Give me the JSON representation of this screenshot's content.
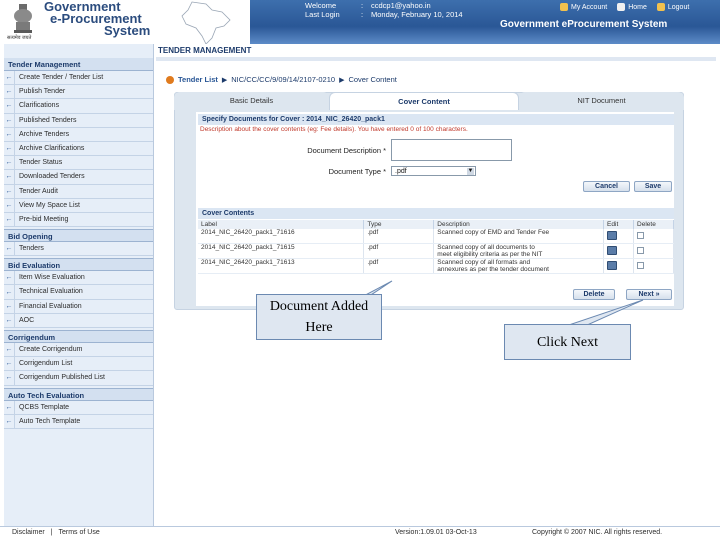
{
  "header": {
    "emblem_caption": "सत्यमेव जयते",
    "brand_lines": [
      "Government",
      "e-Procurement",
      "System"
    ],
    "welcome_label": "Welcome",
    "welcome_value": "ccdcp1@yahoo.in",
    "last_login_label": "Last Login",
    "last_login_value": "Monday, February 10, 2014",
    "links": {
      "account": "My Account",
      "home": "Home",
      "logout": "Logout"
    },
    "system_title": "Government eProcurement System"
  },
  "page_heading": "TENDER MANAGEMENT",
  "sidebar": {
    "title": "Tender Management",
    "groups": [
      {
        "items": [
          "Create Tender / Tender List",
          "Publish Tender",
          "Clarifications",
          "Published Tenders",
          "Archive Tenders",
          "Archive Clarifications",
          "Tender Status",
          "Downloaded Tenders",
          "Tender Audit",
          "View My Space List",
          "Pre-bid Meeting"
        ]
      },
      {
        "section": "Bid Opening",
        "items": [
          "Tenders"
        ]
      },
      {
        "section": "Bid Evaluation",
        "items": [
          "Item Wise Evaluation",
          "Technical Evaluation",
          "Financial Evaluation",
          "AOC"
        ]
      },
      {
        "section": "Corrigendum",
        "items": [
          "Create Corrigendum",
          "Corrigendum List",
          "Corrigendum Published List"
        ]
      },
      {
        "section": "Auto Tech Evaluation",
        "items": [
          "QCBS Template",
          "Auto Tech Template"
        ]
      }
    ]
  },
  "breadcrumb": {
    "link": "Tender List",
    "id": "NIC/CC/CC/9/09/14/2107-0210",
    "current": "Cover Content"
  },
  "tabs": [
    "Basic Details",
    "Cover Content",
    "NIT Document"
  ],
  "spec": {
    "title": "Specify Documents for Cover : 2014_NIC_26420_pack1",
    "description": "Description about the cover contents (eg: Fee details). You have entered 0 of 100 characters.",
    "doc_desc_label": "Document Description *",
    "doc_type_label": "Document Type *",
    "doc_type_value": ".pdf",
    "cancel": "Cancel",
    "save": "Save"
  },
  "cover_contents": {
    "title": "Cover Contents",
    "columns": [
      "Label",
      "Type",
      "Description",
      "Edit",
      "Delete"
    ],
    "rows": [
      {
        "label": "2014_NIC_26420_pack1_71616",
        "type": ".pdf",
        "desc1": "Scanned copy of EMD and Tender Fee",
        "desc2": ""
      },
      {
        "label": "2014_NIC_26420_pack1_71615",
        "type": ".pdf",
        "desc1": "Scanned copy of all documents to",
        "desc2": "meet eligibility criteria as per the NIT"
      },
      {
        "label": "2014_NIC_26420_pack1_71613",
        "type": ".pdf",
        "desc1": "Scanned copy of all formats and",
        "desc2": "annexures as per the tender document"
      }
    ],
    "delete_button": "Delete",
    "next_button": "Next »"
  },
  "callouts": {
    "document_added": [
      "Document Added",
      "Here"
    ],
    "click_next": "Click Next"
  },
  "footer": {
    "disclaimer": "Disclaimer",
    "separator": "|",
    "terms": "Terms of Use",
    "version": "Version:1.09.01 03-Oct-13",
    "copyright": "Copyright © 2007 NIC. All rights reserved."
  },
  "colors": {
    "header_blue": "#2a5796",
    "sidebar_bg": "#e6eef8",
    "panel_bg": "#dde6ef",
    "alert_red": "#c0392b",
    "accent_orange": "#e07b1e"
  }
}
